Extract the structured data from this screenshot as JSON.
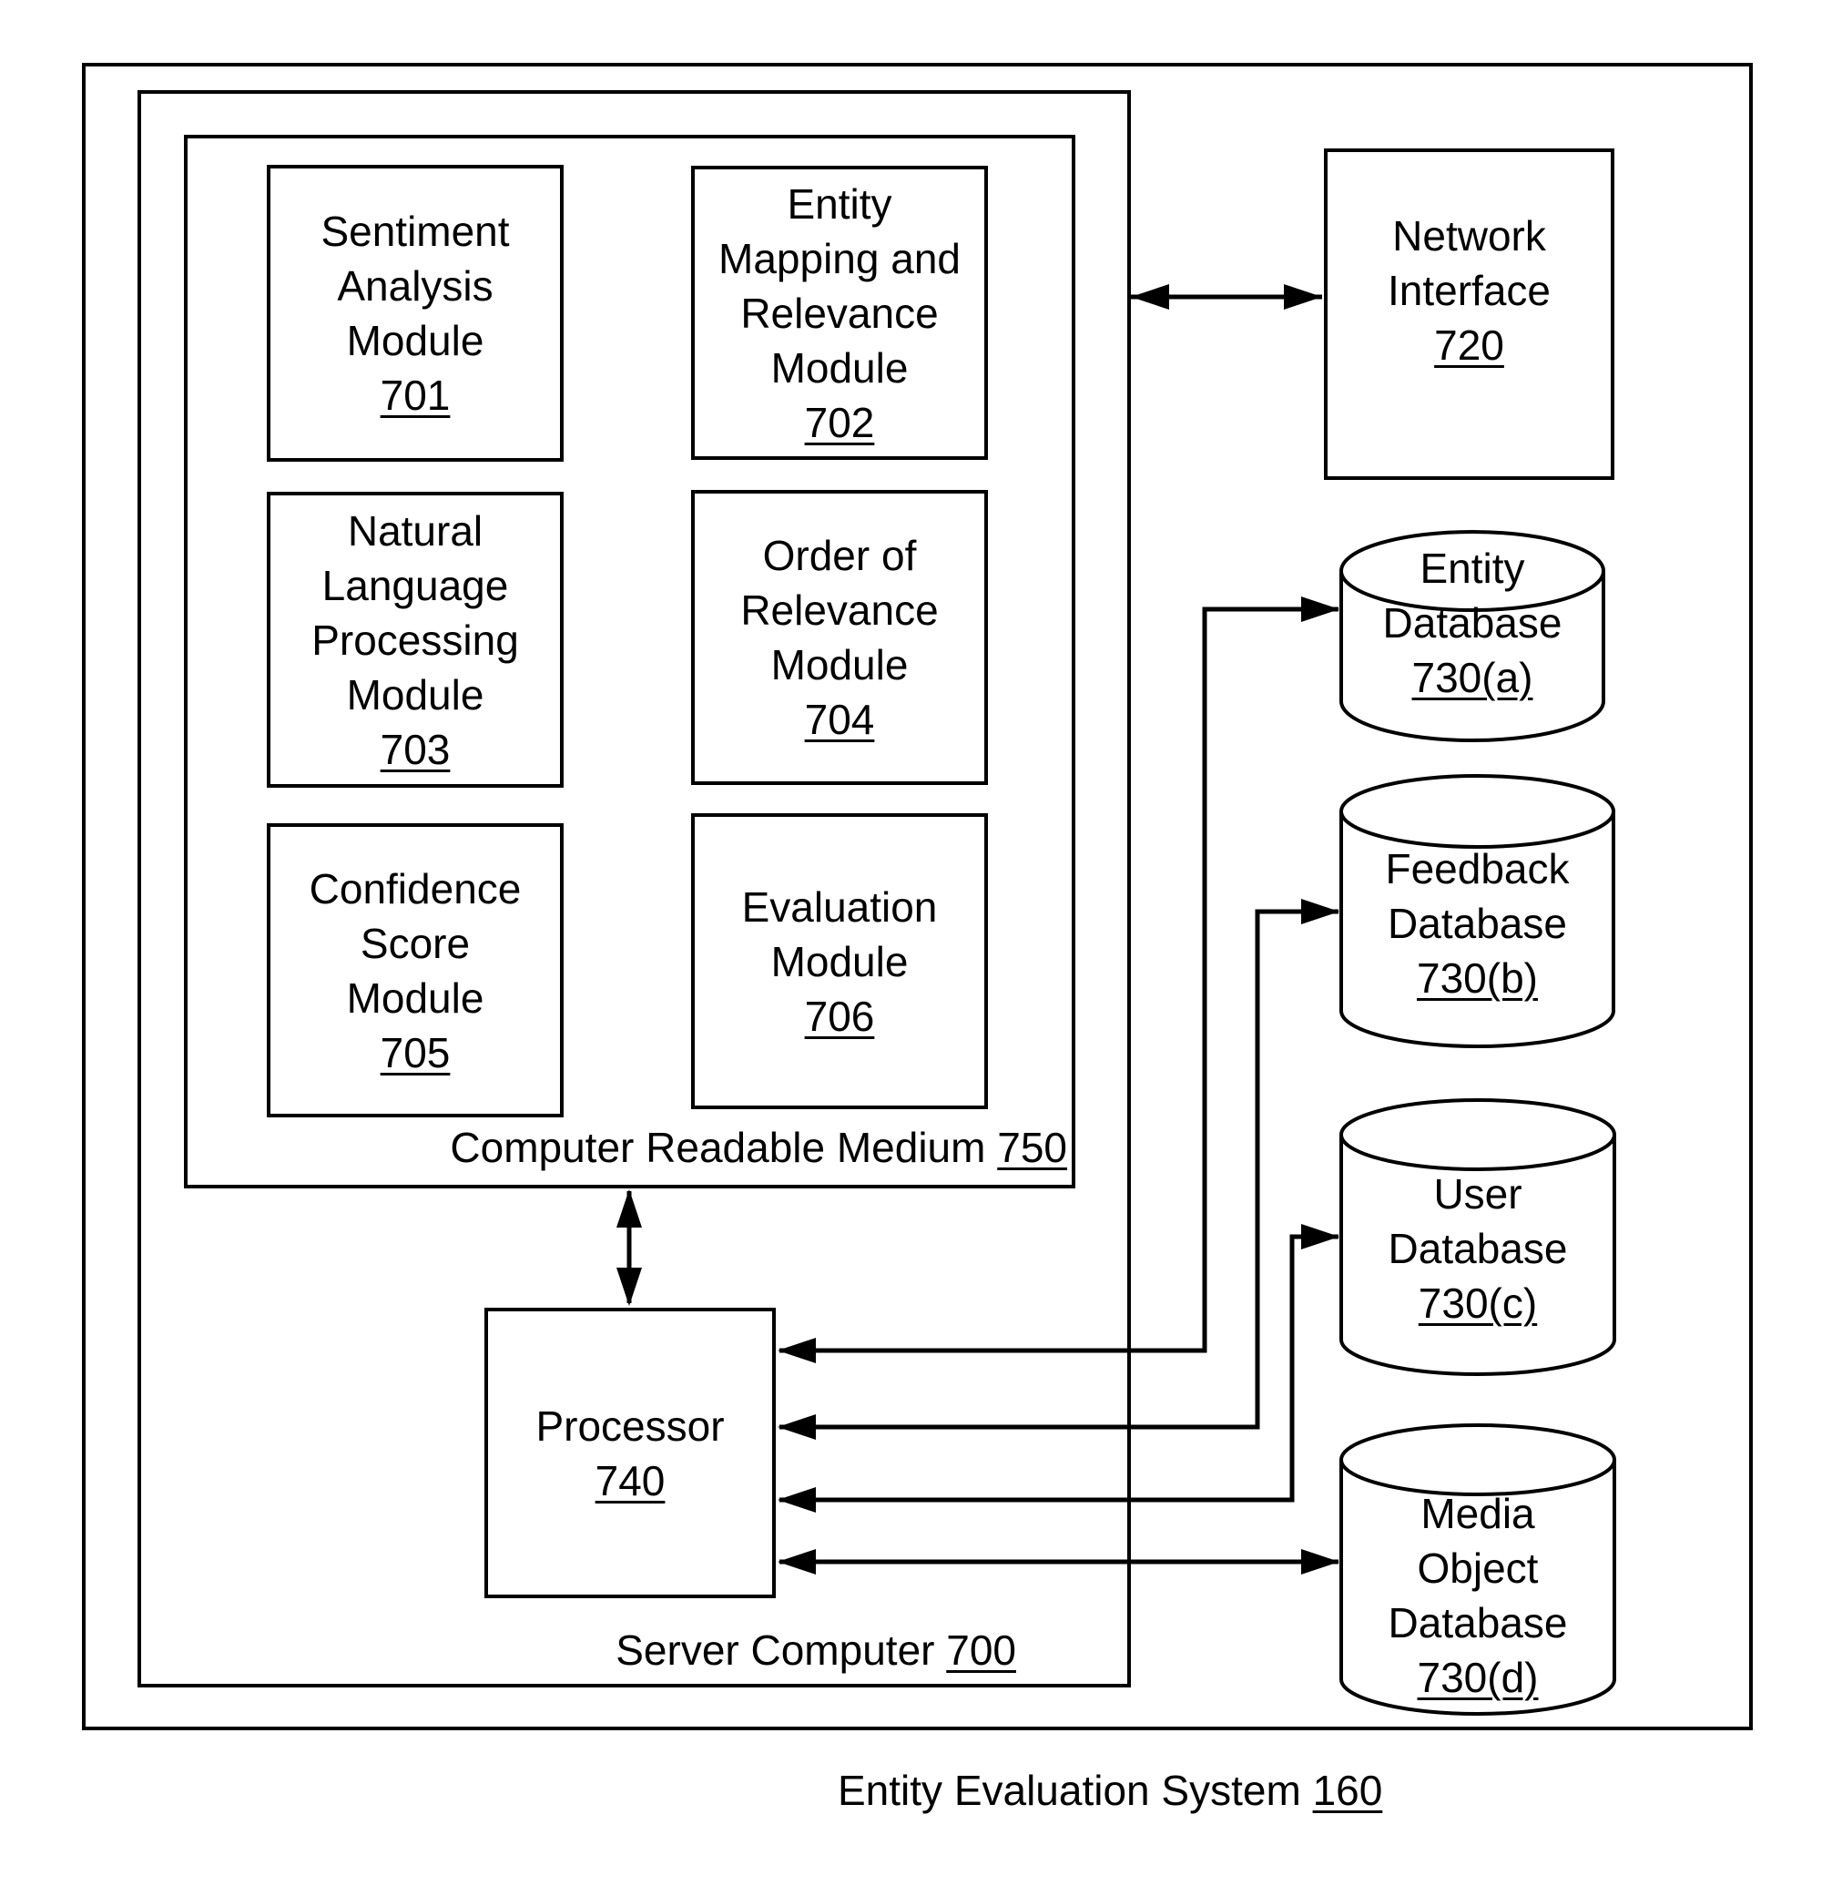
{
  "diagram": {
    "caption": {
      "title": "Entity Evaluation System",
      "ref": "160"
    },
    "server": {
      "title": "Server Computer",
      "ref": "700"
    },
    "medium": {
      "title": "Computer Readable Medium",
      "ref": "750"
    },
    "modules": [
      {
        "lines": [
          "Sentiment",
          "Analysis",
          "Module"
        ],
        "ref": "701"
      },
      {
        "lines": [
          "Entity",
          "Mapping and",
          "Relevance",
          "Module"
        ],
        "ref": "702"
      },
      {
        "lines": [
          "Natural",
          "Language",
          "Processing",
          "Module"
        ],
        "ref": "703"
      },
      {
        "lines": [
          "Order of",
          "Relevance",
          "Module"
        ],
        "ref": "704"
      },
      {
        "lines": [
          "Confidence",
          "Score",
          "Module"
        ],
        "ref": "705"
      },
      {
        "lines": [
          "Evaluation",
          "Module"
        ],
        "ref": "706"
      }
    ],
    "processor": {
      "lines": [
        "Processor"
      ],
      "ref": "740"
    },
    "network_interface": {
      "lines": [
        "Network",
        "Interface"
      ],
      "ref": "720"
    },
    "databases": [
      {
        "lines": [
          "Entity",
          "Database"
        ],
        "ref": "730(a)"
      },
      {
        "lines": [
          "Feedback",
          "Database"
        ],
        "ref": "730(b)"
      },
      {
        "lines": [
          "User",
          "Database"
        ],
        "ref": "730(c)"
      },
      {
        "lines": [
          "Media",
          "Object",
          "Database"
        ],
        "ref": "730(d)"
      }
    ],
    "connections": [
      {
        "from": "Computer Readable Medium 750",
        "to": "Processor 740",
        "direction": "bidirectional"
      },
      {
        "from": "Server Computer 700",
        "to": "Network Interface 720",
        "direction": "bidirectional"
      },
      {
        "from": "Processor 740",
        "to": "Entity Database 730(a)",
        "direction": "bidirectional"
      },
      {
        "from": "Processor 740",
        "to": "Feedback Database 730(b)",
        "direction": "bidirectional"
      },
      {
        "from": "Processor 740",
        "to": "User Database 730(c)",
        "direction": "bidirectional"
      },
      {
        "from": "Processor 740",
        "to": "Media Object Database 730(d)",
        "direction": "bidirectional"
      }
    ]
  }
}
